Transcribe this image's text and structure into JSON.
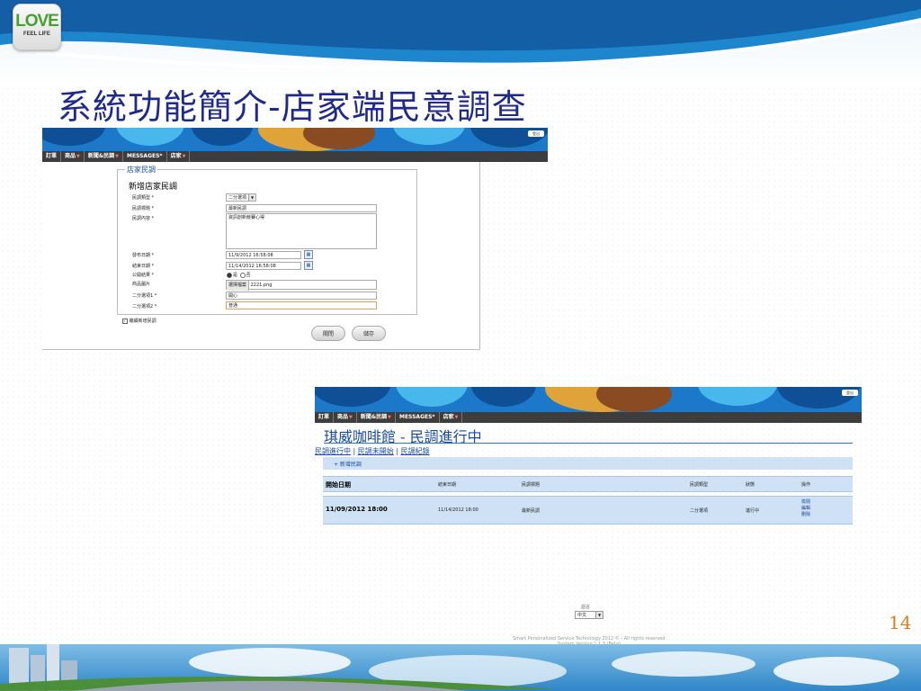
{
  "logo": {
    "text": "LOVE",
    "sub": "FEEL LIFE"
  },
  "slide": {
    "title": "系統功能簡介-店家端民意調查",
    "page_number": "14"
  },
  "nav": {
    "items": [
      {
        "label": "訂單"
      },
      {
        "label": "商品",
        "arrow": "▼"
      },
      {
        "label": "新聞&民調",
        "arrow": "▼"
      },
      {
        "label": "MESSAGES*",
        "arrow": ""
      },
      {
        "label": "店家",
        "arrow": "▼"
      }
    ],
    "banner_button": "登出"
  },
  "form": {
    "legend": "店家民調",
    "title": "新增店家民調",
    "fields": {
      "type_label": "民調類型 *",
      "type_value": "二分選項",
      "title_label": "民調標題 *",
      "title_value": "最新民調",
      "content_label": "民調內容 *",
      "content_value": "資訊創新競賽心得",
      "start_label": "發布日期 *",
      "start_value": "11/9/2012 16:58:08",
      "end_label": "結束日期 *",
      "end_value": "11/14/2012 16:58:08",
      "public_label": "公開結果 *",
      "public_yes": "是",
      "public_no": "否",
      "image_label": "商品圖片",
      "file_button": "選擇檔案",
      "file_name": "2221.png",
      "opt1_label": "二分選項1 *",
      "opt1_value": "開心",
      "opt2_label": "二分選項2 *",
      "opt2_value": "普通"
    },
    "continue_label": "繼續新增民調",
    "close_button": "關閉",
    "save_button": "儲存"
  },
  "survey": {
    "shop_title": "琪威咖啡館 - 民調進行中",
    "tabs": [
      "民調進行中",
      "民調未開始",
      "民調紀錄"
    ],
    "tab_sep": "|",
    "add_link": "+ 新增民調",
    "columns": [
      "開始日期",
      "結束日期",
      "民調標題",
      "民調類型",
      "狀態",
      "操作"
    ],
    "row": {
      "start": "11/09/2012 18:00",
      "end": "11/14/2012 18:00",
      "title": "最新民調",
      "type": "二分選項",
      "status": "進行中",
      "actions": [
        "檢閱",
        "編輯",
        "刪除"
      ]
    }
  },
  "footer": {
    "lang_label": "語言",
    "lang_value": "中文",
    "copyright": "Smart Personalized Service Technology 2012 © - All rights reserved",
    "version": "System Version 1.1.3 (Beta)"
  },
  "colors": {
    "title": "#1f2a8a",
    "accent": "#1a4aa0",
    "page_number": "#e07a1a",
    "navbar": "#3d3d3d"
  }
}
